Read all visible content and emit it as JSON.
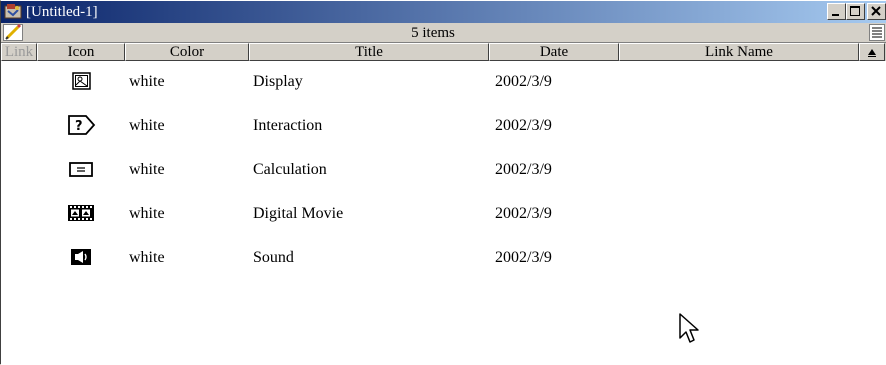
{
  "window": {
    "title": "[Untitled-1]"
  },
  "toolbar": {
    "item_count": "5 items"
  },
  "columns": [
    "Link",
    "Icon",
    "Color",
    "Title",
    "Date",
    "Link Name"
  ],
  "rows": [
    {
      "icon": "display-icon",
      "color": "white",
      "title": "Display",
      "date": "2002/3/9",
      "link_name": ""
    },
    {
      "icon": "interaction-icon",
      "color": "white",
      "title": "Interaction",
      "date": "2002/3/9",
      "link_name": ""
    },
    {
      "icon": "calculation-icon",
      "color": "white",
      "title": "Calculation",
      "date": "2002/3/9",
      "link_name": ""
    },
    {
      "icon": "digital-movie-icon",
      "color": "white",
      "title": "Digital Movie",
      "date": "2002/3/9",
      "link_name": ""
    },
    {
      "icon": "sound-icon",
      "color": "white",
      "title": "Sound",
      "date": "2002/3/9",
      "link_name": ""
    }
  ],
  "colors": {
    "titlebar_start": "#0a246a",
    "titlebar_end": "#a6caf0",
    "chrome": "#d4d0c8"
  }
}
